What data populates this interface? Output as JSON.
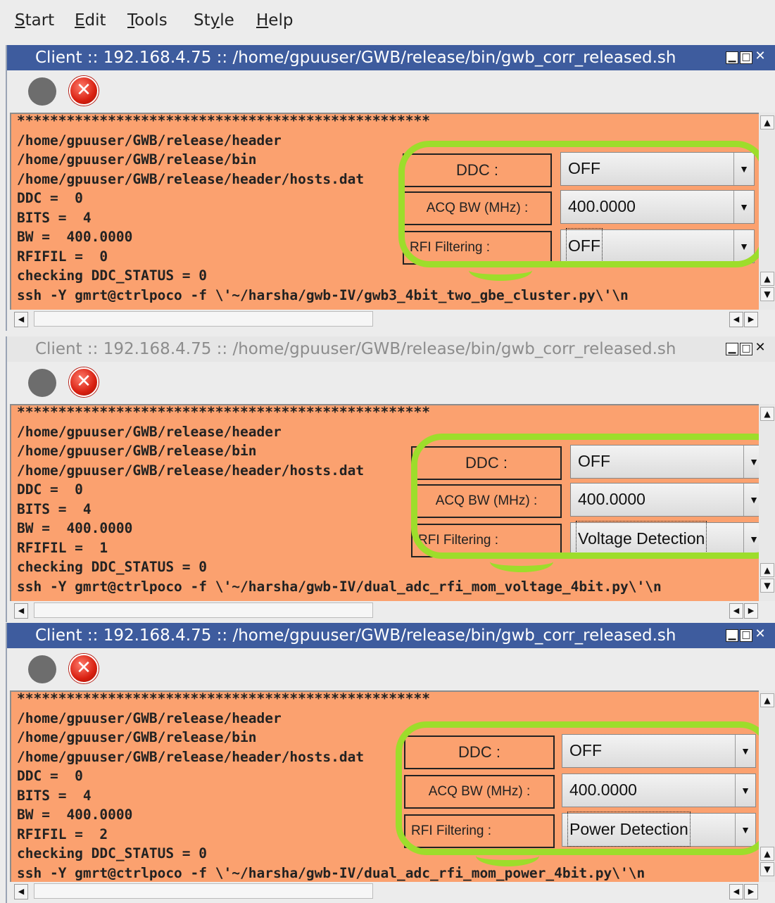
{
  "menubar": {
    "items": [
      {
        "first": "S",
        "rest": "tart"
      },
      {
        "first": "E",
        "rest": "dit"
      },
      {
        "first": "T",
        "rest": "ools"
      },
      {
        "pre": "St",
        "first": "y",
        "rest": "le"
      },
      {
        "first": "H",
        "rest": "elp"
      }
    ]
  },
  "windows": [
    {
      "title": "Client :: 192.168.4.75 :: /home/gpuuser/GWB/release/bin/gwb_corr_released.sh",
      "console": [
        "**************************************************",
        "/home/gpuuser/GWB/release/header",
        "/home/gpuuser/GWB/release/bin",
        "/home/gpuuser/GWB/release/header/hosts.dat",
        "DDC =  0",
        "BITS =  4",
        "BW =  400.0000",
        "RFIFIL =  0",
        "checking DDC_STATUS = 0",
        "ssh -Y gmrt@ctrlpoco -f \\'~/harsha/gwb-IV/gwb3_4bit_two_gbe_cluster.py\\'\\n"
      ],
      "controls": {
        "ddc_label": "DDC :",
        "ddc_value": "OFF",
        "acq_label": "ACQ BW (MHz) :",
        "acq_value": "400.0000",
        "rfi_label": "RFI Filtering :",
        "rfi_value": "OFF"
      }
    },
    {
      "title": "Client :: 192.168.4.75 :: /home/gpuuser/GWB/release/bin/gwb_corr_released.sh",
      "console": [
        "**************************************************",
        "/home/gpuuser/GWB/release/header",
        "/home/gpuuser/GWB/release/bin",
        "/home/gpuuser/GWB/release/header/hosts.dat",
        "DDC =  0",
        "BITS =  4",
        "BW =  400.0000",
        "RFIFIL =  1",
        "checking DDC_STATUS = 0",
        "ssh -Y gmrt@ctrlpoco -f \\'~/harsha/gwb-IV/dual_adc_rfi_mom_voltage_4bit.py\\'\\n"
      ],
      "controls": {
        "ddc_label": "DDC :",
        "ddc_value": "OFF",
        "acq_label": "ACQ BW (MHz) :",
        "acq_value": "400.0000",
        "rfi_label": "RFI Filtering :",
        "rfi_value": "Voltage Detection"
      }
    },
    {
      "title": "Client :: 192.168.4.75 :: /home/gpuuser/GWB/release/bin/gwb_corr_released.sh",
      "console": [
        "**************************************************",
        "/home/gpuuser/GWB/release/header",
        "/home/gpuuser/GWB/release/bin",
        "/home/gpuuser/GWB/release/header/hosts.dat",
        "DDC =  0",
        "BITS =  4",
        "BW =  400.0000",
        "RFIFIL =  2",
        "checking DDC_STATUS = 0",
        "ssh -Y gmrt@ctrlpoco -f \\'~/harsha/gwb-IV/dual_adc_rfi_mom_power_4bit.py\\'\\n"
      ],
      "controls": {
        "ddc_label": "DDC :",
        "ddc_value": "OFF",
        "acq_label": "ACQ BW (MHz) :",
        "acq_value": "400.0000",
        "rfi_label": "RFI Filtering :",
        "rfi_value": "Power Detection"
      }
    }
  ],
  "icons": {
    "window_minimize": "minimize-icon",
    "window_maximize": "maximize-icon",
    "window_close": "close-icon",
    "run": "record-circle-icon",
    "stop": "stop-x-icon",
    "dropdown": "chevron-down-icon"
  },
  "colors": {
    "console_bg": "#fba16f",
    "titlebar_active": "#3e5c9e",
    "highlight_ring": "#9ddd2b"
  }
}
